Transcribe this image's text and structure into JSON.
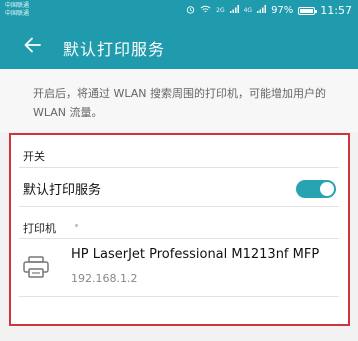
{
  "status_bar": {
    "carrier_1": "中国联通",
    "carrier_2": "中国联通",
    "network_1": "2G",
    "network_2": "4G",
    "battery": "97%",
    "battery_level": 0.97,
    "time": "11:57",
    "icons": [
      "alarm-icon",
      "wifi-icon",
      "signal-icon",
      "signal-icon",
      "battery-icon"
    ]
  },
  "titlebar": {
    "back_icon": "back-arrow-icon",
    "title": "默认打印服务"
  },
  "description": "开启后，将通过 WLAN 搜索周围的打印机，可能增加用户的 WLAN 流量。",
  "switch_section": {
    "label": "开关",
    "row_label": "默认打印服务",
    "toggle_on": true
  },
  "printers_section": {
    "label": "打印机",
    "items": [
      {
        "icon": "printer-icon",
        "name": "HP LaserJet Professional M1213nf MFP",
        "ip": "192.168.1.2"
      }
    ]
  },
  "colors": {
    "accent": "#1f9bad",
    "toggle": "#27a3b1",
    "highlight_border": "#d2343d"
  }
}
